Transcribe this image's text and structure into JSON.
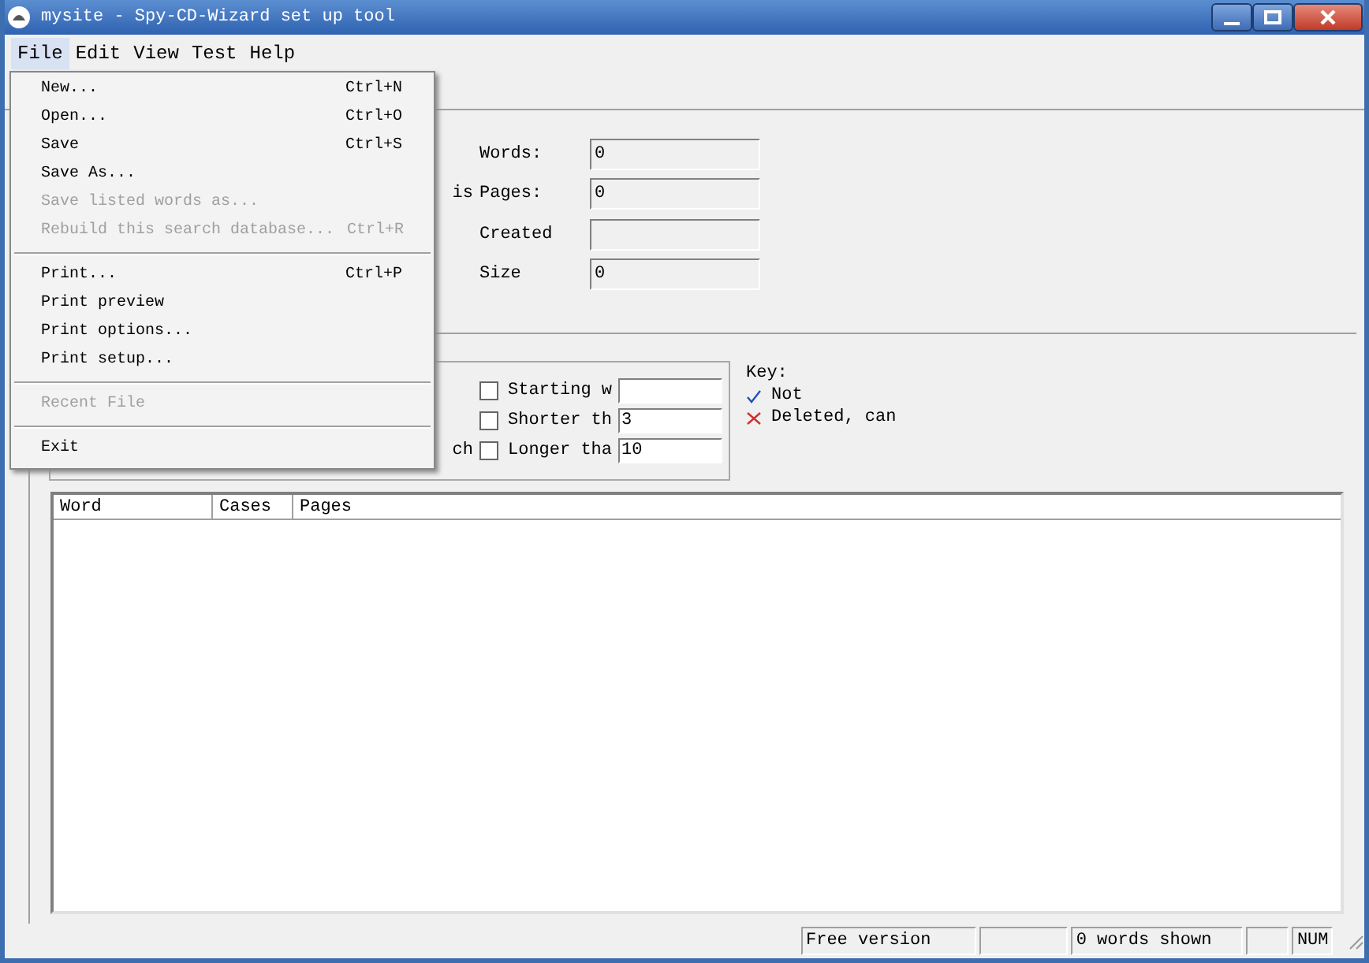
{
  "window": {
    "title": "mysite - Spy-CD-Wizard set up tool"
  },
  "menu_bar": [
    {
      "label": "File",
      "selected": true
    },
    {
      "label": "Edit",
      "selected": false
    },
    {
      "label": "View",
      "selected": false
    },
    {
      "label": "Test",
      "selected": false
    },
    {
      "label": "Help",
      "selected": false
    }
  ],
  "file_menu": [
    {
      "kind": "item",
      "label": "New...",
      "shortcut": "Ctrl+N",
      "disabled": false
    },
    {
      "kind": "item",
      "label": "Open...",
      "shortcut": "Ctrl+O",
      "disabled": false
    },
    {
      "kind": "item",
      "label": "Save",
      "shortcut": "Ctrl+S",
      "disabled": false
    },
    {
      "kind": "item",
      "label": "Save As...",
      "disabled": false
    },
    {
      "kind": "item",
      "label": "Save listed words as...",
      "disabled": true
    },
    {
      "kind": "item",
      "label": "Rebuild this search database...",
      "shortcut": "Ctrl+R",
      "disabled": true
    },
    {
      "kind": "separator"
    },
    {
      "kind": "item",
      "label": "Print...",
      "shortcut": "Ctrl+P",
      "disabled": false
    },
    {
      "kind": "item",
      "label": "Print preview",
      "disabled": false
    },
    {
      "kind": "item",
      "label": "Print options...",
      "disabled": false
    },
    {
      "kind": "item",
      "label": "Print setup...",
      "disabled": false
    },
    {
      "kind": "separator"
    },
    {
      "kind": "item",
      "label": "Recent File",
      "disabled": true
    },
    {
      "kind": "separator"
    },
    {
      "kind": "item",
      "label": "Exit",
      "disabled": false
    }
  ],
  "info": [
    {
      "label": "Words:",
      "value": "0"
    },
    {
      "fragment": "is",
      "label": "Pages:",
      "value": "0"
    },
    {
      "label": "Created"
    },
    {
      "label": "Size",
      "value": "0"
    }
  ],
  "filters": [
    {
      "label": "Starting w",
      "checked": false
    },
    {
      "label": "Shorter th",
      "checked": false,
      "value": "3"
    },
    {
      "fragment": "ch",
      "label": "Longer tha",
      "checked": false,
      "value": "10"
    }
  ],
  "key": {
    "title": "Key:",
    "items": [
      {
        "kind": "check",
        "label": "Not"
      },
      {
        "kind": "cross",
        "label": "Deleted, can"
      }
    ]
  },
  "table": {
    "columns": [
      "Word",
      "Cases",
      "Pages"
    ]
  },
  "status_bar": [
    "Free version",
    "0 words shown",
    "NUM"
  ]
}
